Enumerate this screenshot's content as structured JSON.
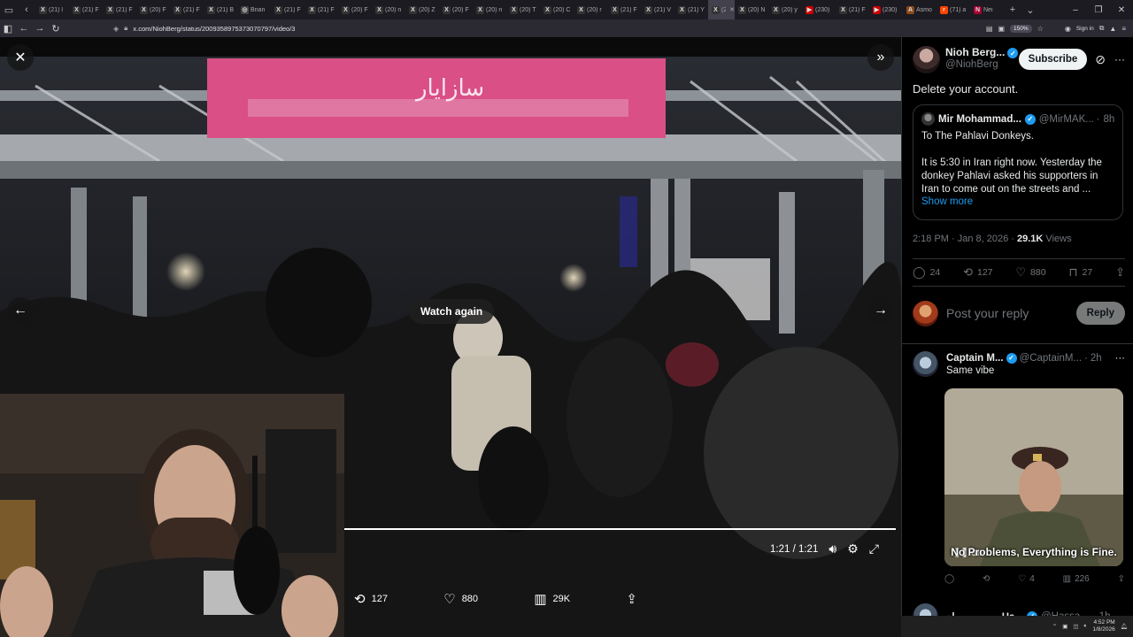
{
  "browser": {
    "tabs": [
      {
        "label": "(21) l",
        "icon": "x-logo"
      },
      {
        "label": "(21) F",
        "icon": "x-logo"
      },
      {
        "label": "(21) F",
        "icon": "x-logo"
      },
      {
        "label": "(20) F",
        "icon": "x-logo"
      },
      {
        "label": "(21) F",
        "icon": "x-logo"
      },
      {
        "label": "(21) B",
        "icon": "x-logo"
      },
      {
        "label": "Brian",
        "icon": "globe"
      },
      {
        "label": "(21) F",
        "icon": "x-logo"
      },
      {
        "label": "(21) F",
        "icon": "x-logo"
      },
      {
        "label": "(20) F",
        "icon": "x-logo"
      },
      {
        "label": "(20) n",
        "icon": "x-logo"
      },
      {
        "label": "(20) Z",
        "icon": "x-logo"
      },
      {
        "label": "(20) F",
        "icon": "x-logo"
      },
      {
        "label": "(20) n",
        "icon": "x-logo"
      },
      {
        "label": "(20) T",
        "icon": "x-logo"
      },
      {
        "label": "(20) C",
        "icon": "x-logo"
      },
      {
        "label": "(20) r",
        "icon": "x-logo"
      },
      {
        "label": "(21) F",
        "icon": "x-logo"
      },
      {
        "label": "(21) V",
        "icon": "x-logo"
      },
      {
        "label": "(21) Y",
        "icon": "x-logo"
      },
      {
        "label": "(21)",
        "icon": "x-logo",
        "active": true
      },
      {
        "label": "(20) N",
        "icon": "x-logo"
      },
      {
        "label": "(20) y",
        "icon": "x-logo"
      },
      {
        "label": "(230)",
        "icon": "youtube"
      },
      {
        "label": "(21) F",
        "icon": "x-logo"
      },
      {
        "label": "(230)",
        "icon": "youtube"
      },
      {
        "label": "Asmo",
        "icon": "asmon"
      },
      {
        "label": "(71) a",
        "icon": "reddit"
      },
      {
        "label": "Nei",
        "icon": "news"
      }
    ],
    "url": "x.com/NiohBerg/status/2009358975373070797/video/3",
    "zoom": "150%",
    "signin_label": "Sign in"
  },
  "viewer": {
    "watch_again": "Watch again",
    "time": "1:21 / 1:21",
    "progress": 1.0,
    "actions": {
      "reposts": "127",
      "likes": "880",
      "views": "29K"
    }
  },
  "post": {
    "author_name": "Nioh Berg...",
    "author_handle": "@NiohBerg",
    "subscribe_label": "Subscribe",
    "text": "Delete your account.",
    "quote": {
      "name": "Mir Mohammad...",
      "handle": "@MirMAK...",
      "time": "8h",
      "line1": "To The Pahlavi Donkeys.",
      "line2": "It is 5:30 in Iran right now. Yesterday the donkey Pahlavi asked his supporters in Iran to come out on the streets and ...",
      "show_more": "Show more"
    },
    "timestamp": "2:18 PM · Jan 8, 2026 · ",
    "views_count": "29.1K",
    "views_label": " Views",
    "stats": {
      "replies": "24",
      "reposts": "127",
      "likes": "880",
      "bookmarks": "27"
    },
    "reply_placeholder": "Post your reply",
    "reply_button": "Reply"
  },
  "replies": [
    {
      "name": "Captain M...",
      "handle": "@CaptainM...",
      "time": "2h",
      "text": "Same vibe",
      "gif_caption": "No Problems, Everything is Fine.",
      "gif_badge": "GIF",
      "stats": {
        "reposts": "",
        "likes": "4",
        "views": "226"
      }
    },
    {
      "name": "حسن صباح - Ha...",
      "handle": "@Hassa...",
      "time": "1h"
    }
  ],
  "system": {
    "time": "4:52 PM",
    "date": "1/8/2026"
  },
  "colors": {
    "accent": "#1d9bf0",
    "muted": "#71767b",
    "border": "#2f3336"
  }
}
